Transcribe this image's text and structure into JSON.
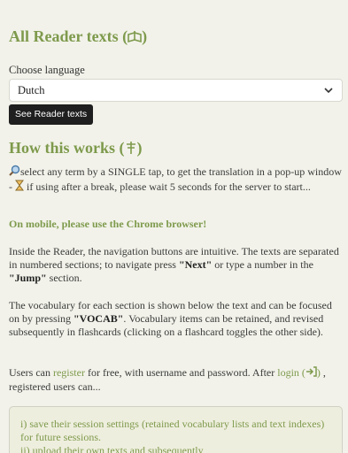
{
  "header": {
    "title": "All Reader texts",
    "title_icon": "book-icon"
  },
  "language": {
    "label": "Choose language",
    "selected": "Dutch"
  },
  "see_button_label": "See Reader texts",
  "how": {
    "title": "How this works",
    "title_icon": "signpost-icon",
    "intro_part1": "select any term by a SINGLE tap, to get the translation in a pop-up window -",
    "intro_part2": "if using after a break, please wait 5 seconds for the server to start...",
    "mobile_note": "On mobile, please use the Chrome browser!",
    "nav_part1": "Inside the Reader, the navigation buttons are intuitive. The texts are separated in numbered sections; to navigate press",
    "nav_next": "\"Next\"",
    "nav_part2": "or type a number in the",
    "nav_jump": "\"Jump\"",
    "nav_part3": "section.",
    "vocab_part1": "The vocabulary for each section is shown below the text and can be focused on by pressing",
    "vocab_key": "\"VOCAB\"",
    "vocab_part2": ". Vocabulary items can be retained, and revised subsequently in flashcards (clicking on a flashcard toggles the other side).",
    "users_part1": "Users can",
    "register_link": "register",
    "users_part2": "for free, with username and password. After",
    "login_link": "login (",
    "login_icon": "login-arrow-icon",
    "login_close": ")",
    "users_part3": ", registered users can..."
  },
  "benefits": {
    "item1": "i) save their session settings (retained vocabulary lists and text indexes) for future sessions.",
    "item2": "ii) upload their own texts and subsequently"
  }
}
